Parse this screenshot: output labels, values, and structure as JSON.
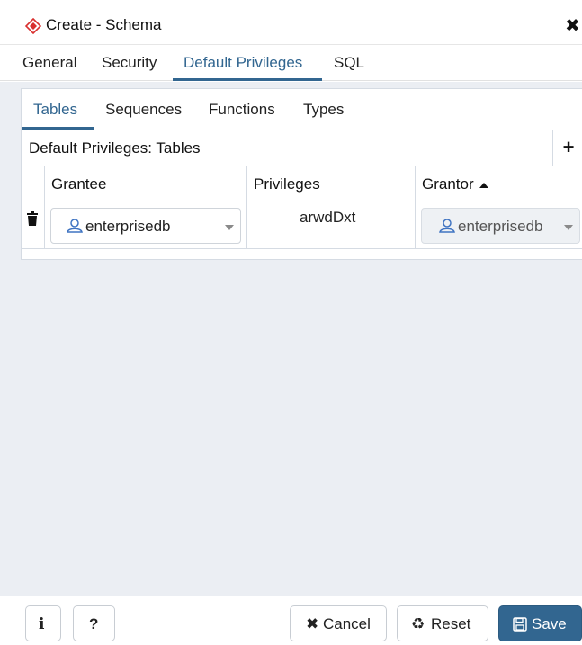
{
  "window": {
    "title": "Create - Schema",
    "app_icon": "pgadmin-diamond-icon",
    "close_icon": "close-icon"
  },
  "main_tabs": [
    {
      "label": "General",
      "active": false
    },
    {
      "label": "Security",
      "active": false
    },
    {
      "label": "Default Privileges",
      "active": true
    },
    {
      "label": "SQL",
      "active": false
    }
  ],
  "sub_tabs": [
    {
      "label": "Tables",
      "active": true
    },
    {
      "label": "Sequences",
      "active": false
    },
    {
      "label": "Functions",
      "active": false
    },
    {
      "label": "Types",
      "active": false
    }
  ],
  "grid": {
    "title": "Default Privileges: Tables",
    "add_icon": "plus-icon",
    "columns": [
      {
        "label": "Grantee"
      },
      {
        "label": "Privileges"
      },
      {
        "label": "Grantor",
        "sorted": "ascending"
      }
    ],
    "rows": [
      {
        "delete_icon": "trash-icon",
        "grantee": "enterprisedb",
        "privileges": "arwdDxt",
        "grantor": "enterprisedb"
      }
    ]
  },
  "footer": {
    "info_label": "i",
    "help_label": "?",
    "cancel_label": "Cancel",
    "reset_label": "Reset",
    "save_label": "Save"
  },
  "colors": {
    "accent": "#326690",
    "content_bg": "#ebeef3",
    "border": "#d5dbe3"
  }
}
